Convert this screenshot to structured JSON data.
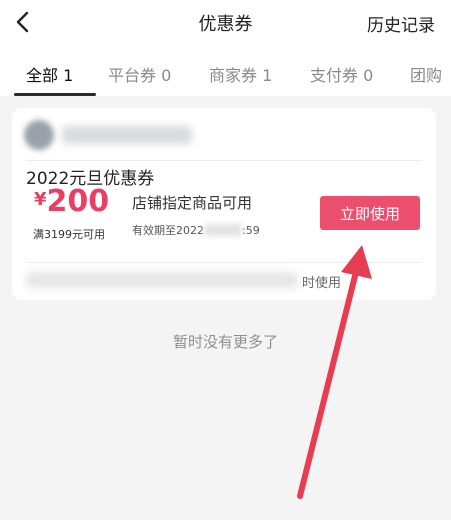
{
  "header": {
    "title": "优惠券",
    "history_label": "历史记录"
  },
  "tabs": [
    {
      "label": "全部 1"
    },
    {
      "label": "平台券 0"
    },
    {
      "label": "商家券 1"
    },
    {
      "label": "支付券 0"
    },
    {
      "label": "团购"
    }
  ],
  "coupon": {
    "title": "2022元旦优惠券",
    "currency": "¥",
    "amount": "200",
    "threshold": "满3199元可用",
    "description": "店铺指定商品可用",
    "validity_prefix": "有效期至2022",
    "validity_suffix": ":59",
    "use_button": "立即使用",
    "footer_suffix": "时使用"
  },
  "empty_hint": "暂时没有更多了",
  "colors": {
    "accent": "#ea3f64",
    "button": "#ec4f6e",
    "annotation_arrow": "#e83c50"
  }
}
